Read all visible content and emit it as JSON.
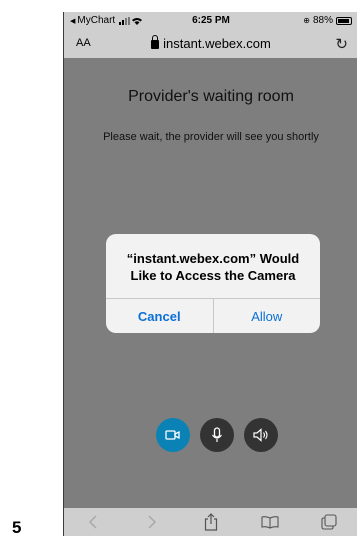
{
  "step_number": "5",
  "status_bar": {
    "back_app": "MyChart",
    "time": "6:25 PM",
    "battery": "88%"
  },
  "browser": {
    "text_size_label": "AA",
    "url": "instant.webex.com"
  },
  "page": {
    "title": "Provider's waiting room",
    "subtitle": "Please wait, the provider will see you shortly"
  },
  "permission_dialog": {
    "title": "“instant.webex.com” Would Like to Access the Camera",
    "cancel_label": "Cancel",
    "allow_label": "Allow"
  },
  "colors": {
    "accent": "#0a82b5",
    "link": "#0a6fd8",
    "overlay": "#7e7e7e"
  },
  "icons": {
    "camera": "video-camera-icon",
    "microphone": "microphone-icon",
    "speaker": "speaker-icon"
  }
}
